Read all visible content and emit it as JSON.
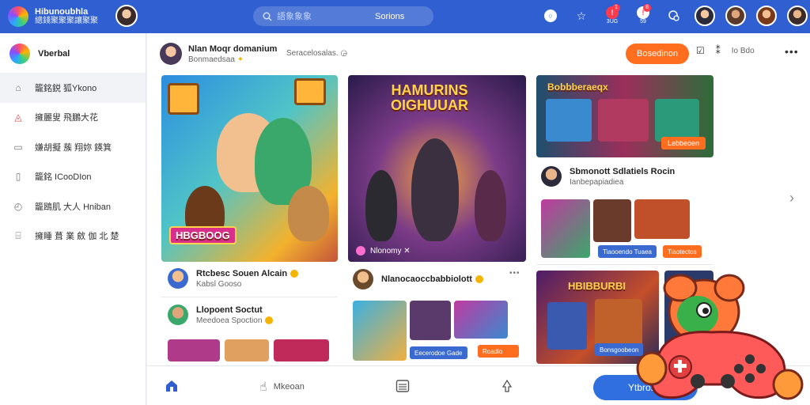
{
  "topbar": {
    "brand_title": "Hibunoubhla",
    "brand_sub": "總錢聚聚聚讓聚聚",
    "search_placeholder": "語象象象",
    "search_button": "Sorions",
    "icons": [
      {
        "name": "home-circle-icon",
        "glyph": "○",
        "badge": "",
        "caption": ""
      },
      {
        "name": "star-icon",
        "glyph": "☆",
        "badge": "",
        "caption": ""
      },
      {
        "name": "notification-icon",
        "glyph": "!",
        "badge": "1",
        "caption": "3UG"
      },
      {
        "name": "alert-icon",
        "glyph": "!",
        "badge": "8",
        "caption": "59"
      },
      {
        "name": "chat-icon",
        "glyph": "◯",
        "badge": "",
        "caption": ""
      },
      {
        "name": "profile-icon",
        "glyph": "●",
        "badge": "",
        "caption": ""
      }
    ]
  },
  "sidebar": {
    "title": "Vberbal",
    "items": [
      {
        "label": "籠銘鋭 狐Ykono",
        "icon": "home-icon",
        "glyph": "⌂"
      },
      {
        "label": "擁麗叟 飛鵬大花",
        "icon": "user-icon",
        "glyph": "◬"
      },
      {
        "label": "嫌胡擬 蔟 翔妳 鍈箕",
        "icon": "window-icon",
        "glyph": "▭"
      },
      {
        "label": "籠銘 ICooDIon",
        "icon": "document-icon",
        "glyph": "▯"
      },
      {
        "label": "籠鴎肌 大人 Hniban",
        "icon": "clock-icon",
        "glyph": "◴"
      },
      {
        "label": "擁睡 葺 業 斂 伽 北 楚",
        "icon": "chart-icon",
        "glyph": "⌸"
      }
    ]
  },
  "header": {
    "name": "Nlan Moqr domanium",
    "sub": "Bonmaedsaa ",
    "meta": "Seracelosalas.",
    "follow_label": "Bosedinon",
    "share_label": "Io Bdo"
  },
  "cards": {
    "art1_title": "HBGBOOG",
    "art2_title": "HAMURINS\nOIGHUUAR",
    "art2_caption": "Nlonomy",
    "art3_title": "Bobbberaeqx",
    "art3_badge": "Lebbeoen",
    "art4_title": "HBIBBURBI"
  },
  "posts": [
    {
      "name": "Rtcbesc Souen Alcain",
      "sub": "Kabsl Gooso"
    },
    {
      "name": "Llopoent Soctut",
      "sub": "Meedoea Spoction"
    },
    {
      "name": "Nlanocaoccbabbiolott",
      "sub": ""
    },
    {
      "name": "Sbmonott Sdlatiels Rocin",
      "sub": "Ianbepapiadiea"
    }
  ],
  "chips": {
    "c1": "Eecerodoe Gade",
    "c2": "Roadio",
    "c3": "Tiaooendo Tuaea",
    "c4": "Tiaotectos",
    "c5": "Bonsgoobeon"
  },
  "bottomnav": {
    "items": [
      {
        "label": "",
        "icon": "home-icon"
      },
      {
        "label": "Mkeoan",
        "icon": "heart-hand-icon"
      },
      {
        "label": "",
        "icon": "list-icon"
      },
      {
        "label": "",
        "icon": "upload-icon"
      }
    ],
    "primary_label": "Ytbrosin"
  },
  "colors": {
    "topbar": "#2f5fd0",
    "accent_orange": "#ff6d1f",
    "primary_blue": "#2f6fe0"
  }
}
